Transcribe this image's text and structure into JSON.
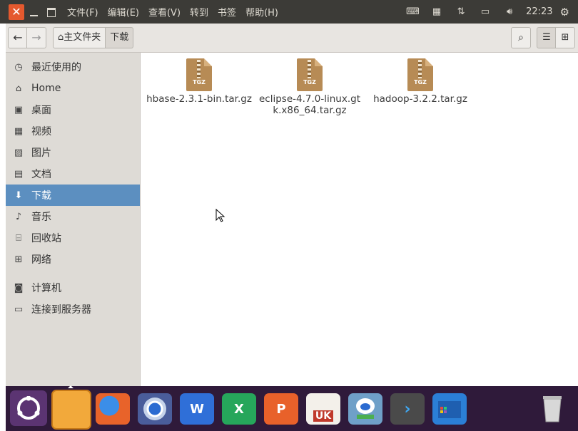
{
  "topbar": {
    "menu": [
      "文件(F)",
      "编辑(E)",
      "查看(V)",
      "转到",
      "书签",
      "帮助(H)"
    ],
    "clock": "22:23"
  },
  "toolbar": {
    "breadcrumb": [
      "主文件夹",
      "下载"
    ]
  },
  "sidebar": {
    "items": [
      {
        "label": "最近使用的",
        "icon": "clock-icon"
      },
      {
        "label": "Home",
        "icon": "home-icon"
      },
      {
        "label": "桌面",
        "icon": "desktop-icon"
      },
      {
        "label": "视频",
        "icon": "video-icon"
      },
      {
        "label": "图片",
        "icon": "picture-icon"
      },
      {
        "label": "文档",
        "icon": "document-icon"
      },
      {
        "label": "下载",
        "icon": "download-icon",
        "active": true
      },
      {
        "label": "音乐",
        "icon": "music-icon"
      },
      {
        "label": "回收站",
        "icon": "trash-icon"
      },
      {
        "label": "网络",
        "icon": "network-icon"
      },
      {
        "label": "计算机",
        "icon": "computer-icon"
      },
      {
        "label": "连接到服务器",
        "icon": "server-icon"
      }
    ]
  },
  "files": [
    {
      "name": "hbase-2.3.1-bin.tar.gz",
      "type_label": "TGZ"
    },
    {
      "name": "eclipse-4.7.0-linux.gtk.x86_64.tar.gz",
      "type_label": "TGZ"
    },
    {
      "name": "hadoop-3.2.2.tar.gz",
      "type_label": "TGZ"
    }
  ],
  "dock": {
    "wps_writer": "W",
    "wps_sheet": "X",
    "wps_present": "P",
    "store_badge": "UK"
  },
  "colors": {
    "accent": "#5c8fc0",
    "topbar": "#3c3b37",
    "close": "#e5592e",
    "dock": "#2f1a3a"
  }
}
